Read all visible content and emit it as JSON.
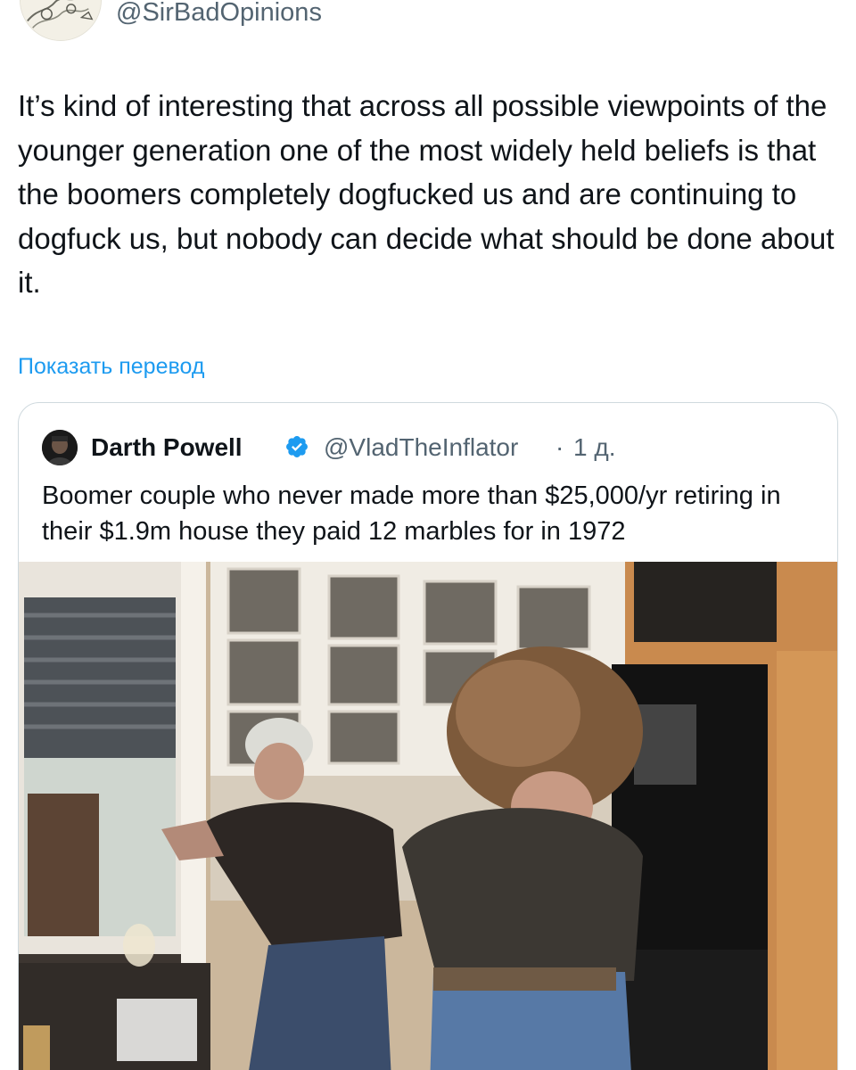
{
  "tweet": {
    "handle": "@SirBadOpinions",
    "text": "It’s kind of interesting that across all possible viewpoints of the younger generation one of the most widely held beliefs is that the boomers completely dogfucked us and are continuing to dogfuck us, but nobody can decide what should be done about it.",
    "translate_label": "Показать перевод"
  },
  "quote": {
    "name": "Darth Powell",
    "handle": "@VladTheInflator",
    "separator": "·",
    "time": "1 д.",
    "text": "Boomer couple who never made more than $25,000/yr retiring in their $1.9m house they paid 12 marbles for in 1972"
  },
  "colors": {
    "link": "#1d9bf0",
    "verified": "#1d9bf0",
    "secondary_text": "#536471",
    "border": "#cfd9de"
  },
  "icons": {
    "verified": "verified-badge-icon"
  }
}
